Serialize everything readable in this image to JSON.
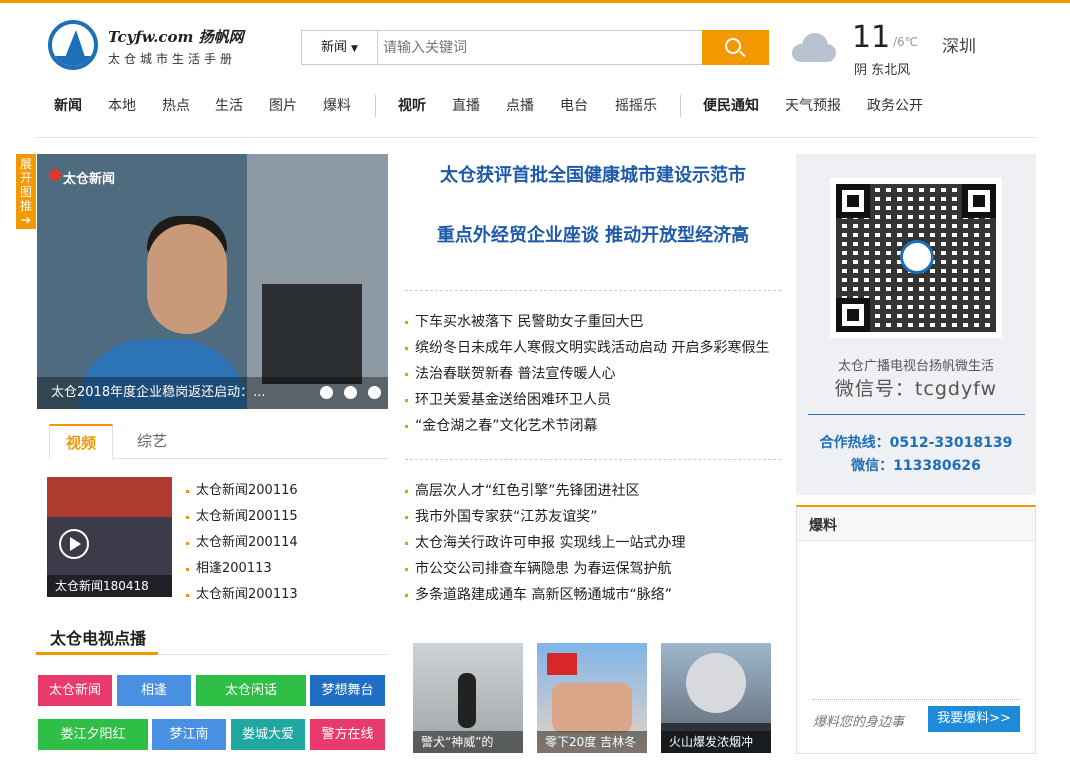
{
  "colors": {
    "accent": "#f39800",
    "blue": "#1d5aa8",
    "link_blue": "#1d8bd8"
  },
  "logo": {
    "line1": "Tcyfw.com 扬帆网",
    "line2": "太仓城市生活手册"
  },
  "search": {
    "category": "新闻",
    "placeholder": "请输入关键词"
  },
  "weather": {
    "temp": "11",
    "range": "/6℃",
    "city": "深圳",
    "desc": "阴 东北风",
    "icon": "cloud-icon"
  },
  "nav": {
    "group1": [
      "新闻",
      "本地",
      "热点",
      "生活",
      "图片",
      "爆料"
    ],
    "group2": [
      "视听",
      "直播",
      "点播",
      "电台",
      "摇摇乐"
    ],
    "group3": [
      "便民通知",
      "天气预报",
      "政务公开"
    ]
  },
  "expand_tab": "展开图推",
  "slider": {
    "brand": "太仓新闻",
    "caption": "太仓2018年度企业稳岗返还启动：...",
    "dots": 4,
    "active_dot": 4
  },
  "video_tabs": [
    "视频",
    "综艺"
  ],
  "video_thumb_caption": "太仓新闻180418",
  "video_list": [
    "太仓新闻200116",
    "太仓新闻200115",
    "太仓新闻200114",
    "相逢200113",
    "太仓新闻200113"
  ],
  "tv_section_title": "太仓电视点播",
  "programs": [
    {
      "label": "太仓新闻",
      "color": "#e93a6e"
    },
    {
      "label": "相逢",
      "color": "#4a90e2"
    },
    {
      "label": "太仓闲话",
      "color": "#2fbf47"
    },
    {
      "label": "梦想舞台",
      "color": "#1e6fc4"
    },
    {
      "label": "娄江夕阳红",
      "color": "#2fbf47"
    },
    {
      "label": "梦江南",
      "color": "#4a90e2"
    },
    {
      "label": "娄城大爱",
      "color": "#1fa7a0"
    },
    {
      "label": "警方在线",
      "color": "#e93a6e"
    }
  ],
  "headlines": [
    "太仓获评首批全国健康城市建设示范市",
    "重点外经贸企业座谈  推动开放型经济高"
  ],
  "news_list_1": [
    "下车买水被落下  民警助女子重回大巴",
    "缤纷冬日未成年人寒假文明实践活动启动  开启多彩寒假生",
    "法治春联贺新春  普法宣传暖人心",
    "环卫关爱基金送给困难环卫人员",
    "“金仓湖之春”文化艺术节闭幕"
  ],
  "news_list_2": [
    "高层次人才“红色引擎”先锋团进社区",
    "我市外国专家获“江苏友谊奖”",
    "太仓海关行政许可申报  实现线上一站式办理",
    "市公交公司排查车辆隐患  为春运保驾护航",
    "多条道路建成通车  高新区畅通城市“脉络”"
  ],
  "photos": [
    {
      "caption": "警犬“神威”的"
    },
    {
      "caption": "零下20度 吉林冬"
    },
    {
      "caption": "火山爆发浓烟冲"
    }
  ],
  "qr": {
    "line1": "太仓广播电视台扬帆微生活",
    "line2": "微信号：tcgdyfw",
    "line3": "合作热线：0512-33018139",
    "line4": "微信：113380626"
  },
  "baoliao": {
    "title": "爆料",
    "hint": "爆料您的身边事",
    "button": "我要爆料>>"
  }
}
